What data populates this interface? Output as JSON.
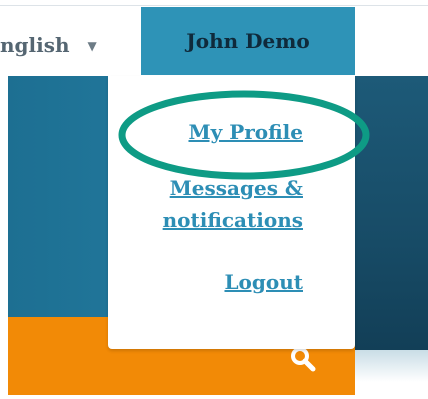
{
  "header": {
    "language": "nglish",
    "language_caret": "▼",
    "user_name": "John Demo"
  },
  "menu": {
    "items": [
      {
        "label": "My Profile"
      },
      {
        "label": "Messages & notifications"
      },
      {
        "label": "Logout"
      }
    ]
  },
  "search": {
    "icon": "search-icon"
  },
  "colors": {
    "user_button": "#2e93b7",
    "link": "#2d8eb5",
    "search_bar": "#f28a06",
    "annotation": "#0e9b85"
  }
}
